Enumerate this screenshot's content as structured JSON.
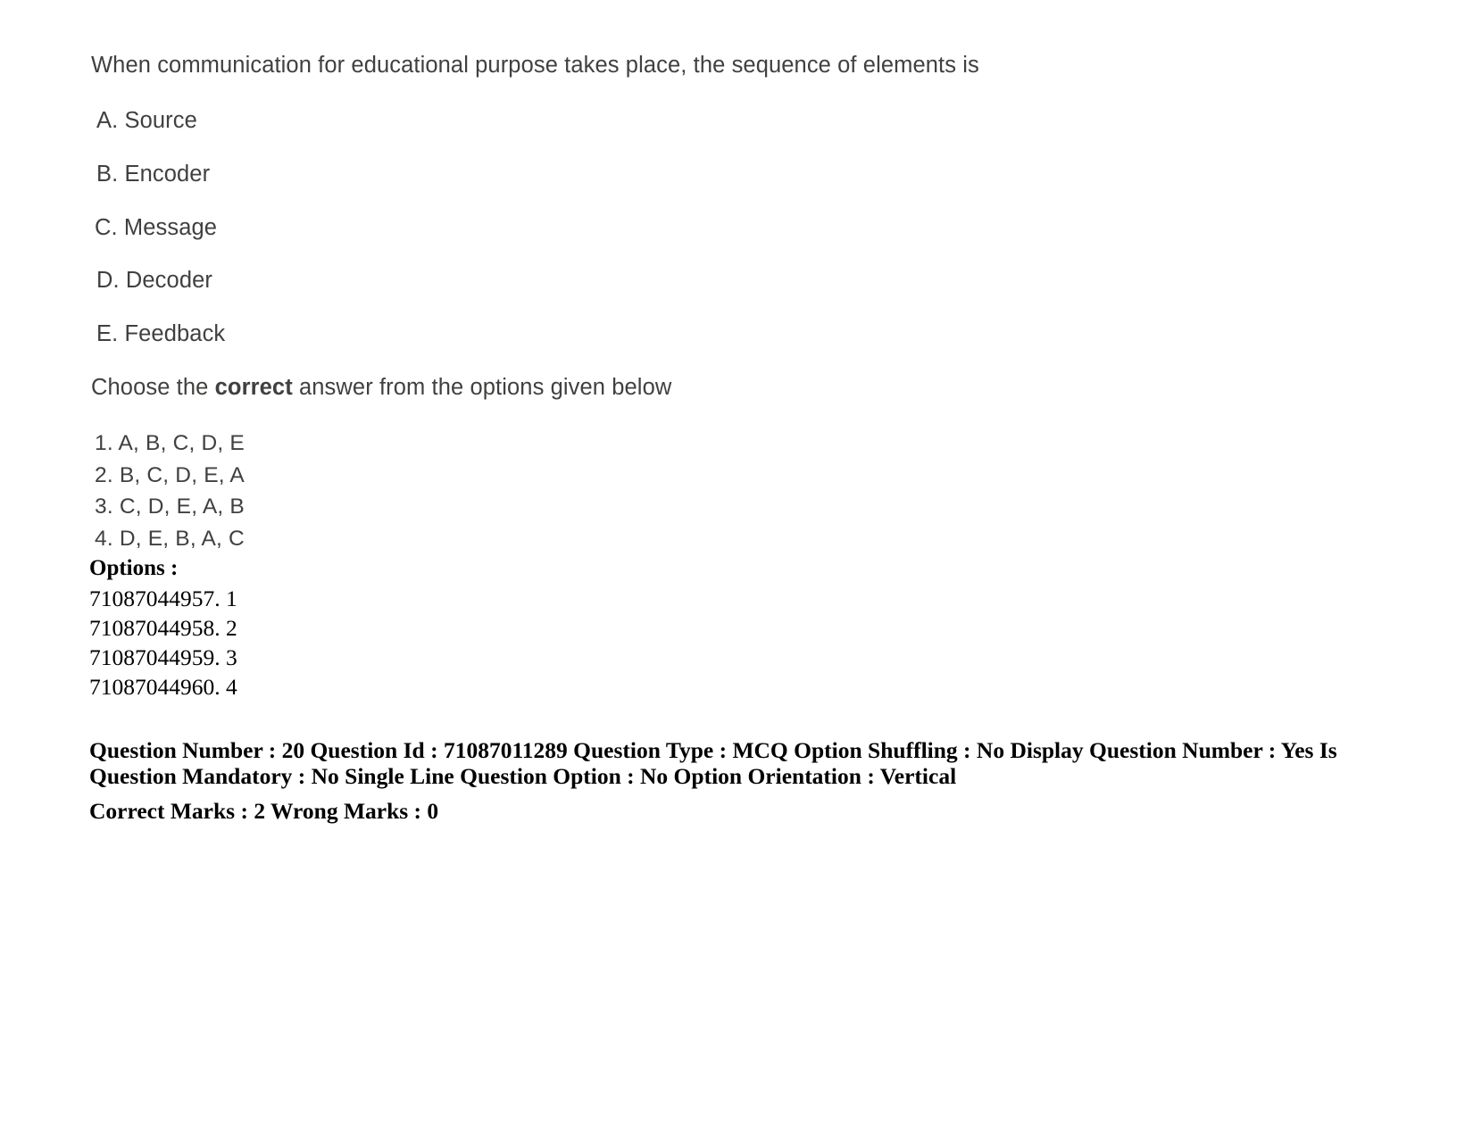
{
  "question": {
    "stem": "When communication for educational purpose takes place, the sequence of elements is",
    "elements": [
      {
        "label": "A. Source"
      },
      {
        "label": "B. Encoder"
      },
      {
        "label": "C. Message"
      },
      {
        "label": "D. Decoder"
      },
      {
        "label": "E. Feedback"
      }
    ],
    "instruction_prefix": "Choose the ",
    "instruction_bold": "correct",
    "instruction_suffix": " answer from the options given below",
    "answer_choices": [
      "1. A, B, C, D, E",
      "2. B, C, D, E, A",
      "3. C, D, E, A, B",
      "4. D, E, B, A, C"
    ]
  },
  "options_section": {
    "label": "Options :",
    "rows": [
      "71087044957. 1",
      "71087044958. 2",
      "71087044959. 3",
      "71087044960. 4"
    ]
  },
  "metadata": {
    "line1": "Question Number : 20 Question Id : 71087011289 Question Type : MCQ Option Shuffling : No Display Question Number : Yes Is Question Mandatory : No Single Line Question Option : No Option Orientation : Vertical",
    "line2": "Correct Marks : 2 Wrong Marks : 0"
  },
  "colors": {
    "page_background": "#ffffff",
    "scanned_text": "#40403f",
    "digital_text": "#000000"
  }
}
